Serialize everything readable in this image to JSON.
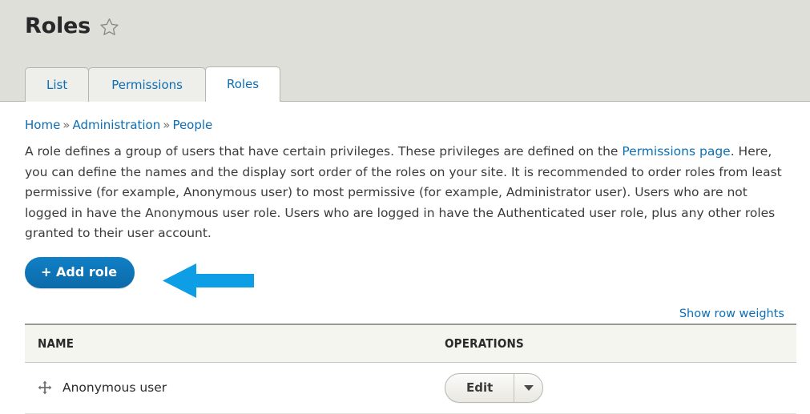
{
  "header": {
    "title": "Roles",
    "favorite_icon": "star-outline-icon",
    "tabs": [
      {
        "label": "List",
        "active": false
      },
      {
        "label": "Permissions",
        "active": false
      },
      {
        "label": "Roles",
        "active": true
      }
    ]
  },
  "breadcrumb": {
    "separator": "»",
    "items": [
      {
        "label": "Home"
      },
      {
        "label": "Administration"
      },
      {
        "label": "People"
      }
    ]
  },
  "intro": {
    "part1": "A role defines a group of users that have certain privileges. These privileges are defined on the ",
    "link": "Permissions page",
    "part2": ". Here, you can define the names and the display sort order of the roles on your site. It is recommended to order roles from least permissive (for example, Anonymous user) to most permissive (for example, Administrator user). Users who are not logged in have the Anonymous user role. Users who are logged in have the Authenticated user role, plus any other roles granted to their user account."
  },
  "actions": {
    "add_role_label": "+ Add role",
    "add_role_color": "#0f75b9",
    "annotation_arrow": {
      "icon": "left-arrow-icon",
      "color": "#0d9ee5",
      "points_to": "+ Add role"
    }
  },
  "table": {
    "show_row_weights_label": "Show row weights",
    "columns": [
      "NAME",
      "OPERATIONS"
    ],
    "rows": [
      {
        "drag_handle_icon": "move-handle-icon",
        "name": "Anonymous user",
        "operation_label": "Edit",
        "operation_toggle_icon": "chevron-down-icon"
      }
    ]
  }
}
